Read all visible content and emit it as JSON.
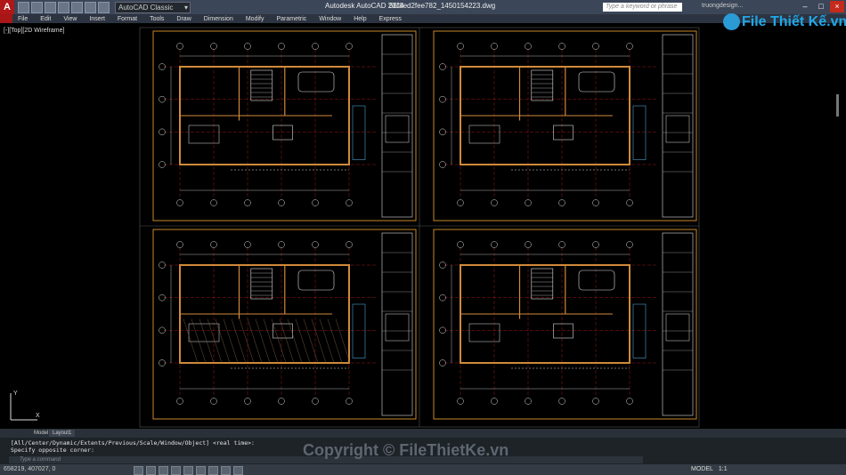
{
  "titlebar": {
    "app_logo": "A",
    "workspace": "AutoCAD Classic",
    "app_title": "Autodesk AutoCAD 2014",
    "file_name": "56f8ed2fee782_1450154223.dwg",
    "search_placeholder": "Type a keyword or phrase",
    "user": "truongdesign..."
  },
  "menu": [
    "File",
    "Edit",
    "View",
    "Insert",
    "Format",
    "Tools",
    "Draw",
    "Dimension",
    "Modify",
    "Parametric",
    "Window",
    "Help",
    "Express"
  ],
  "viewport_label": "[-][Top][2D Wireframe]",
  "logo": {
    "badge": "File",
    "text": "File Thiết Kế.vn"
  },
  "layout_tabs": {
    "model": "Model",
    "layout1": "Layout1"
  },
  "command": {
    "line1": "[All/Center/Dynamic/Extents/Previous/Scale/Window/Object] <real time>:",
    "line2": "Specify opposite corner:",
    "input_placeholder": "Type a command"
  },
  "watermark": "Copyright © FileThietKe.vn",
  "status": {
    "coords": "658219, 407027, 0",
    "model": "MODEL",
    "scale": "1:1"
  },
  "colors": {
    "accent_red": "#b01818",
    "sheet_border": "#c8882a",
    "wall": "#d08a3a",
    "dim": "#e0e0e0",
    "axis": "#c02020",
    "logo_blue": "#1fa7e8"
  }
}
